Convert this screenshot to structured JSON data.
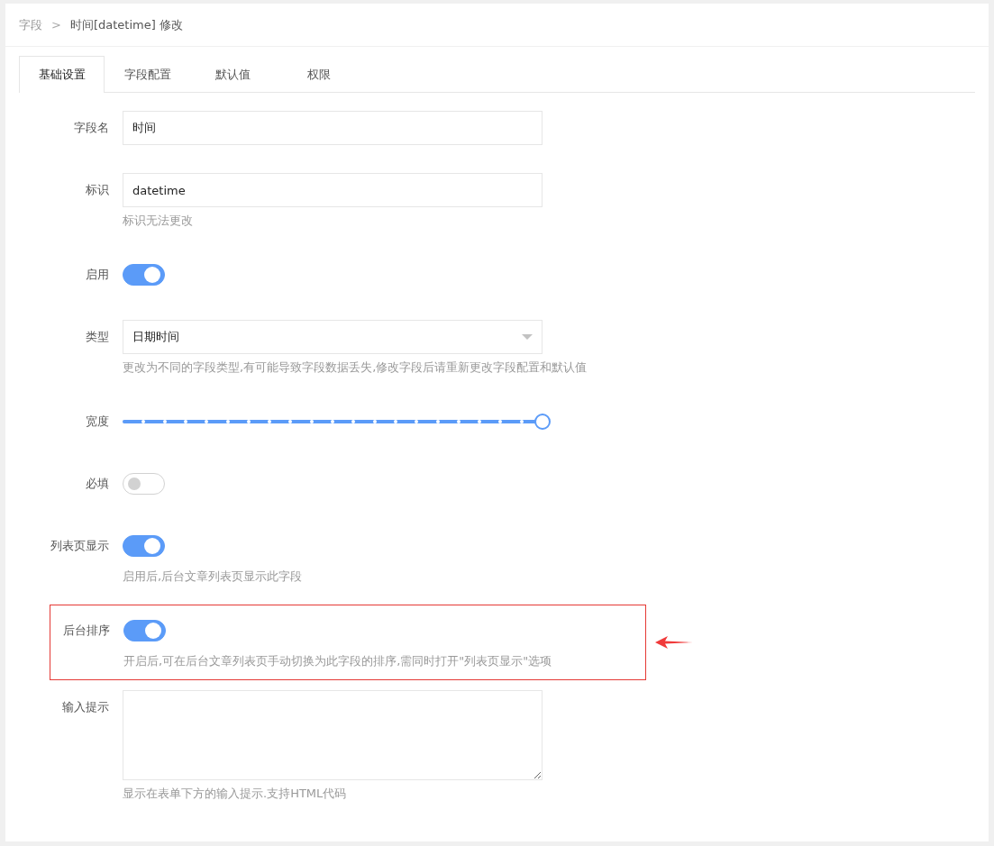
{
  "breadcrumb": {
    "separator": ">",
    "items": [
      "字段",
      "时间[datetime] 修改"
    ]
  },
  "tabs": [
    {
      "label": "基础设置",
      "selected": true
    },
    {
      "label": "字段配置",
      "selected": false
    },
    {
      "label": "默认值",
      "selected": false
    },
    {
      "label": "权限",
      "selected": false
    }
  ],
  "fields": [
    {
      "kind": "text",
      "label": "字段名",
      "value": "时间",
      "highlighted": false
    },
    {
      "kind": "text",
      "label": "标识",
      "value": "datetime",
      "hint": "标识无法更改",
      "highlighted": false
    },
    {
      "kind": "switch",
      "label": "启用",
      "on": true,
      "highlighted": false
    },
    {
      "kind": "select",
      "label": "类型",
      "value": "日期时间",
      "hint": "更改为不同的字段类型,有可能导致字段数据丢失,修改字段后请重新更改字段配置和默认值",
      "highlighted": false
    },
    {
      "kind": "slider",
      "label": "宽度",
      "level": 1,
      "highlighted": false
    },
    {
      "kind": "switch",
      "label": "必填",
      "on": false,
      "highlighted": false
    },
    {
      "kind": "switch",
      "label": "列表页显示",
      "on": true,
      "hint": "启用后,后台文章列表页显示此字段",
      "highlighted": false
    },
    {
      "kind": "switch",
      "label": "后台排序",
      "on": true,
      "hint": "开启后,可在后台文章列表页手动切换为此字段的排序,需同时打开\"列表页显示\"选项",
      "highlighted": true
    },
    {
      "kind": "textarea",
      "label": "输入提示",
      "hint": "显示在表单下方的输入提示.支持HTML代码",
      "highlighted": false
    }
  ]
}
